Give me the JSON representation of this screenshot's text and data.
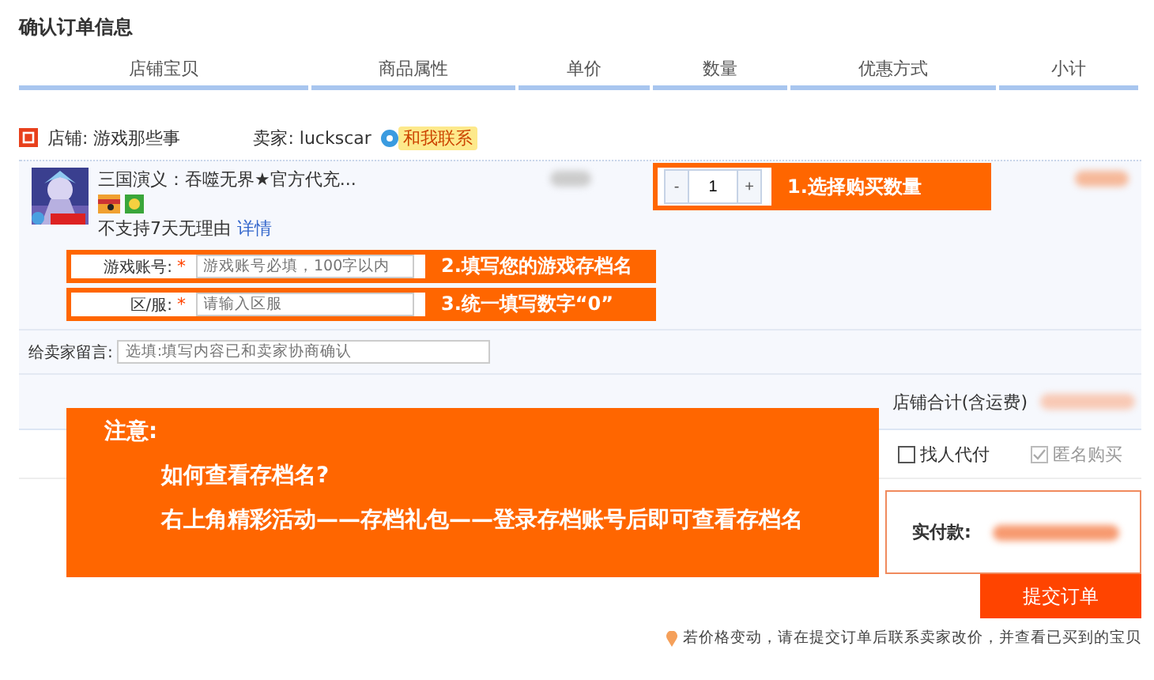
{
  "page_title": "确认订单信息",
  "columns": [
    "店铺宝贝",
    "商品属性",
    "单价",
    "数量",
    "优惠方式",
    "小计"
  ],
  "shop": {
    "name": "店铺: 游戏那些事",
    "seller": "卖家: luckscar",
    "contact": "和我联系"
  },
  "item": {
    "title": "三国演义：吞噬无界★官方代充...",
    "policy": "不支持7天无理由",
    "details_link": "详情",
    "minus": "-",
    "quantity": "1",
    "plus": "+"
  },
  "fields": [
    {
      "label": "游戏账号:",
      "required_mark": "*",
      "placeholder": "游戏账号必填，100字以内"
    },
    {
      "label": "区/服:",
      "required_mark": "*",
      "placeholder": "请输入区服"
    }
  ],
  "message": {
    "label": "给卖家留言:",
    "placeholder": "选填:填写内容已和卖家协商确认"
  },
  "shop_total_label": "店铺合计(含运费)",
  "options": [
    {
      "label": "找人代付",
      "checked": false,
      "disabled": false
    },
    {
      "label": "匿名购买",
      "checked": true,
      "disabled": true
    }
  ],
  "payment_label": "实付款:",
  "submit": "提交订单",
  "notice": "若价格变动，请在提交订单后联系卖家改价，并查看已买到的宝贝",
  "annotations": [
    "1.选择购买数量",
    "2.填写您的游戏存档名",
    "3.统一填写数字“0”"
  ],
  "note": {
    "heading": "注意:",
    "lines": [
      "如何查看存档名?",
      "右上角精彩活动——存档礼包——登录存档账号后即可查看存档名"
    ]
  }
}
